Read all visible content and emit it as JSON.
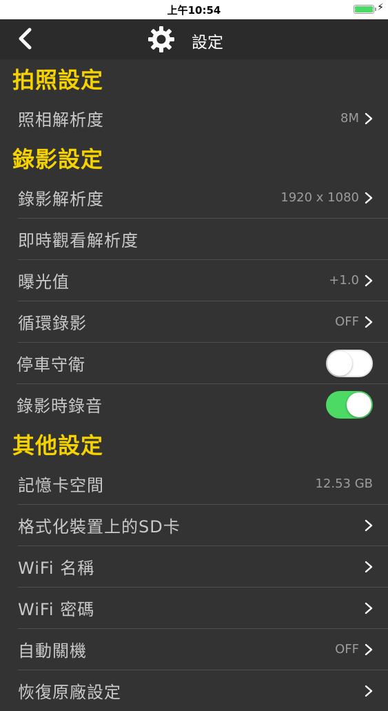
{
  "status_bar": {
    "time": "上午10:54",
    "battery_color": "#4cd964"
  },
  "nav": {
    "title": "設定",
    "back_icon": "chevron-left-icon",
    "settings_icon": "gear-icon"
  },
  "sections": [
    {
      "header": "拍照設定",
      "rows": [
        {
          "label": "照相解析度",
          "value": "8M",
          "chevron": true
        }
      ]
    },
    {
      "header": "錄影設定",
      "rows": [
        {
          "label": "錄影解析度",
          "value": "1920 x 1080",
          "chevron": true
        },
        {
          "label": "即時觀看解析度",
          "value": "",
          "chevron": false
        },
        {
          "label": "曝光值",
          "value": "+1.0",
          "chevron": true
        },
        {
          "label": "循環錄影",
          "value": "OFF",
          "chevron": true
        },
        {
          "label": "停車守衛",
          "toggle": false
        },
        {
          "label": "錄影時錄音",
          "toggle": true
        }
      ]
    },
    {
      "header": "其他設定",
      "rows": [
        {
          "label": "記憶卡空間",
          "value": "12.53 GB",
          "chevron": false
        },
        {
          "label": "格式化裝置上的SD卡",
          "value": "",
          "chevron": true
        },
        {
          "label": "WiFi 名稱",
          "value": "",
          "chevron": true
        },
        {
          "label": "WiFi 密碼",
          "value": "",
          "chevron": true
        },
        {
          "label": "自動關機",
          "value": "OFF",
          "chevron": true
        },
        {
          "label": "恢復原廠設定",
          "value": "",
          "chevron": true
        }
      ]
    }
  ]
}
